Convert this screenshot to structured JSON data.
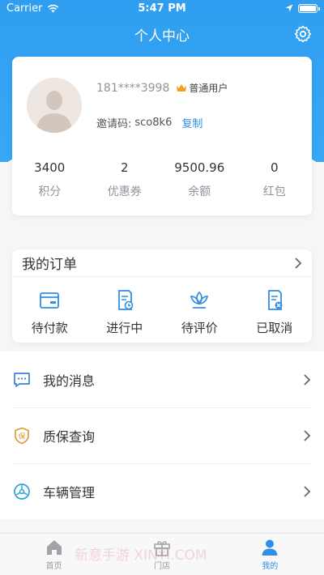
{
  "status_bar": {
    "carrier": "Carrier",
    "time": "5:47 PM"
  },
  "header": {
    "title": "个人中心"
  },
  "profile": {
    "phone": "181****3998",
    "user_type": "普通用户",
    "invite_label": "邀请码:",
    "invite_code": "sco8k6",
    "copy_label": "复制"
  },
  "stats": [
    {
      "value": "3400",
      "label": "积分"
    },
    {
      "value": "2",
      "label": "优惠券"
    },
    {
      "value": "9500.96",
      "label": "余额"
    },
    {
      "value": "0",
      "label": "红包"
    }
  ],
  "orders": {
    "title": "我的订单",
    "items": [
      {
        "label": "待付款",
        "icon": "wallet-icon"
      },
      {
        "label": "进行中",
        "icon": "doc-clock-icon"
      },
      {
        "label": "待评价",
        "icon": "flower-icon"
      },
      {
        "label": "已取消",
        "icon": "doc-cancel-icon"
      }
    ]
  },
  "menu": [
    {
      "label": "我的消息",
      "icon": "message-icon"
    },
    {
      "label": "质保查询",
      "icon": "warranty-icon"
    },
    {
      "label": "车辆管理",
      "icon": "car-manage-icon"
    }
  ],
  "tabs": [
    {
      "label": "首页",
      "icon": "home-icon"
    },
    {
      "label": "门店",
      "icon": "gift-icon"
    },
    {
      "label": "我的",
      "icon": "user-icon"
    }
  ],
  "watermark": "新意手游 XINYI.COM",
  "colors": {
    "primary": "#2f8fe6",
    "header": "#38a7f5",
    "crown": "#f0a020"
  }
}
